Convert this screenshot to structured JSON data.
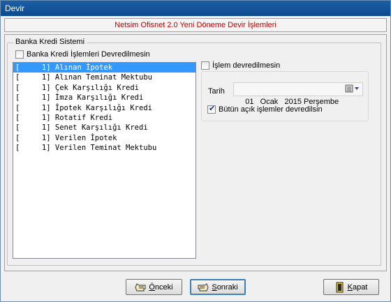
{
  "window": {
    "title": "Devir"
  },
  "banner": {
    "text": "Netsim Ofisnet 2.0 Yeni Döneme Devir İşlemleri"
  },
  "group": {
    "legend": "Banka Kredi Sistemi",
    "checkbox_label": "Banka Kredi İşlemleri Devredilmesin",
    "checkbox_checked": false
  },
  "list": {
    "items": [
      "[     1] Alınan İpotek",
      "[     1] Alınan Teminat Mektubu",
      "[     1] Çek Karşılığı Kredi",
      "[     1] İmza Karşılığı Kredi",
      "[     1] İpotek Karşılığı Kredi",
      "[     1] Rotatif Kredi",
      "[     1] Senet Karşılığı Kredi",
      "[     1] Verilen İpotek",
      "[     1] Verilen Teminat Mektubu"
    ],
    "selected_index": 0
  },
  "options": {
    "no_transfer_label": "İşlem devredilmesin",
    "no_transfer_checked": false,
    "date_label": "Tarih",
    "date_value": "01   Ocak   2015 Perşembe",
    "open_items_label": "Bütün açık işlemler devredilsin",
    "open_items_checked": true
  },
  "buttons": {
    "prev": "Önceki",
    "next": "Sonraki",
    "close": "Kapat"
  },
  "colors": {
    "title_bar": "#1b5fa6",
    "banner_text": "#c00000",
    "selection": "#3399ff"
  }
}
